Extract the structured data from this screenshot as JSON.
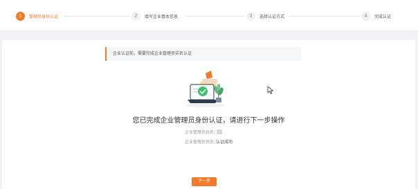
{
  "steps": [
    {
      "num": "1",
      "label": "管理员身份认证"
    },
    {
      "num": "2",
      "label": "填写企业基本信息"
    },
    {
      "num": "3",
      "label": "选择认证方式"
    },
    {
      "num": "4",
      "label": "完成认证"
    }
  ],
  "notice": "企业认证前，需要完成企业管理员实名认证",
  "headline": "您已完成企业管理员身份认证，请进行下一步操作",
  "info": {
    "name_label": "企业管理员姓名：",
    "status_label": "企业管理员状态：",
    "status_value": "认证成功"
  },
  "next_button": "下一步",
  "colors": {
    "accent": "#f07b2a",
    "background": "#f0f2f5"
  }
}
